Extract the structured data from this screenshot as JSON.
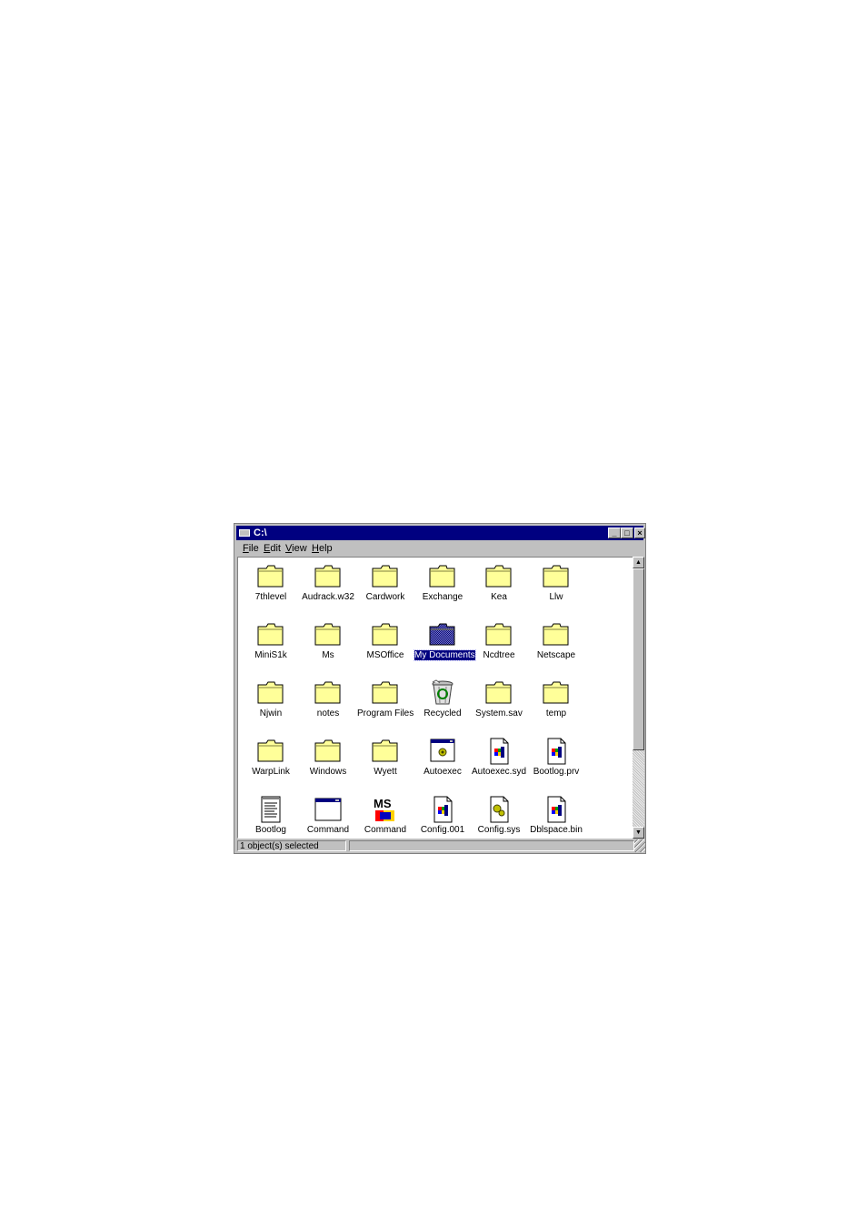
{
  "window": {
    "title": "C:\\",
    "buttons": {
      "minimize": "_",
      "maximize": "□",
      "close": "×"
    }
  },
  "menu": [
    {
      "key": "F",
      "rest": "ile"
    },
    {
      "key": "E",
      "rest": "dit"
    },
    {
      "key": "V",
      "rest": "iew"
    },
    {
      "key": "H",
      "rest": "elp"
    }
  ],
  "items": [
    {
      "label": "7thlevel",
      "icon": "folder-icon"
    },
    {
      "label": "Audrack.w32",
      "icon": "folder-icon"
    },
    {
      "label": "Cardwork",
      "icon": "folder-icon"
    },
    {
      "label": "Exchange",
      "icon": "folder-icon"
    },
    {
      "label": "Kea",
      "icon": "folder-icon"
    },
    {
      "label": "Llw",
      "icon": "folder-icon"
    },
    {
      "label": "MiniS1k",
      "icon": "folder-icon"
    },
    {
      "label": "Ms",
      "icon": "folder-icon"
    },
    {
      "label": "MSOffice",
      "icon": "folder-icon"
    },
    {
      "label": "My Documents",
      "icon": "folder-icon",
      "selected": true
    },
    {
      "label": "Ncdtree",
      "icon": "folder-icon"
    },
    {
      "label": "Netscape",
      "icon": "folder-icon"
    },
    {
      "label": "Njwin",
      "icon": "folder-icon"
    },
    {
      "label": "notes",
      "icon": "folder-icon"
    },
    {
      "label": "Program Files",
      "icon": "folder-icon"
    },
    {
      "label": "Recycled",
      "icon": "recycle-bin-icon"
    },
    {
      "label": "System.sav",
      "icon": "folder-icon"
    },
    {
      "label": "temp",
      "icon": "folder-icon"
    },
    {
      "label": "WarpLink",
      "icon": "folder-icon"
    },
    {
      "label": "Windows",
      "icon": "folder-icon"
    },
    {
      "label": "Wyett",
      "icon": "folder-icon"
    },
    {
      "label": "Autoexec",
      "icon": "batch-file-icon"
    },
    {
      "label": "Autoexec.syd",
      "icon": "system-file-icon"
    },
    {
      "label": "Bootlog.prv",
      "icon": "system-file-icon"
    },
    {
      "label": "Bootlog",
      "icon": "text-file-icon"
    },
    {
      "label": "Command",
      "icon": "program-window-icon"
    },
    {
      "label": "Command",
      "icon": "ms-dos-icon"
    },
    {
      "label": "Config.001",
      "icon": "system-file-icon"
    },
    {
      "label": "Config.sys",
      "icon": "config-file-icon"
    },
    {
      "label": "Dblspace.bin",
      "icon": "system-file-icon"
    }
  ],
  "msdos_icon_text": "MS",
  "status": {
    "text": "1 object(s) selected",
    "right": ""
  },
  "colors": {
    "title_bar": "#000080",
    "folder": "#ffff99",
    "face": "#c0c0c0",
    "selection": "#000080"
  }
}
